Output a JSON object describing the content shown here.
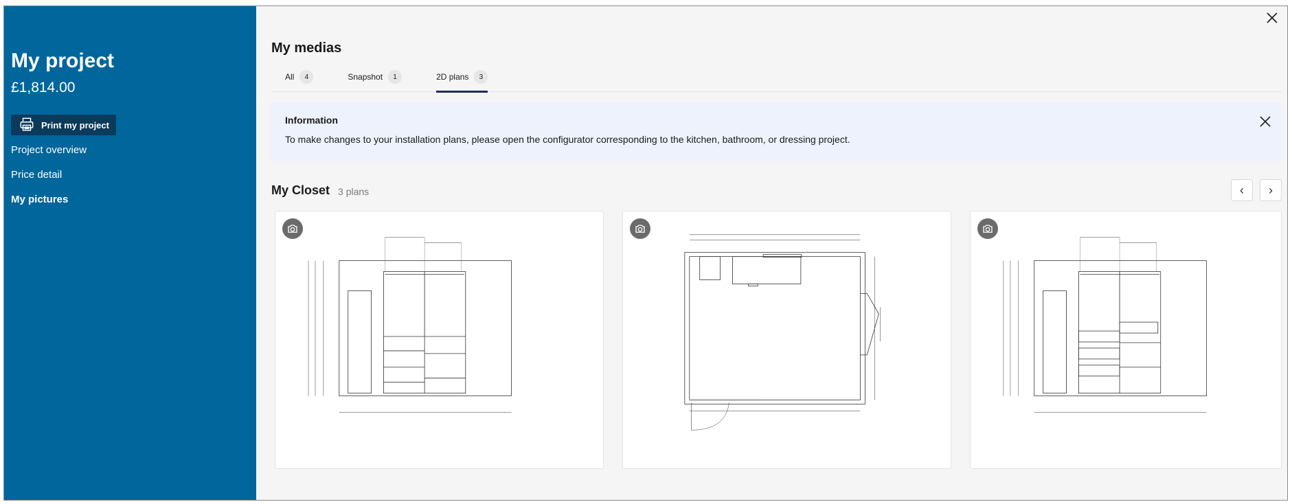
{
  "sidebar": {
    "title": "My project",
    "price": "£1,814.00",
    "print_label": "Print my project",
    "items": [
      {
        "label": "Project overview"
      },
      {
        "label": "Price detail"
      },
      {
        "label": "My pictures"
      }
    ]
  },
  "main": {
    "title": "My medias",
    "tabs": [
      {
        "label": "All",
        "count": "4"
      },
      {
        "label": "Snapshot",
        "count": "1"
      },
      {
        "label": "2D plans",
        "count": "3"
      }
    ],
    "active_tab": "2D plans",
    "info": {
      "title": "Information",
      "text": "To make changes to your installation plans, please open the configurator corresponding to the kitchen, bathroom, or dressing project."
    },
    "section": {
      "title": "My Closet",
      "subtitle": "3 plans",
      "prev": "‹",
      "next": "›"
    }
  },
  "colors": {
    "sidebar_bg": "#00669b",
    "print_btn_bg": "#0b3a5a",
    "tab_underline": "#1f2b5c",
    "info_bg": "#edf2fd"
  },
  "icons": [
    "close-icon",
    "printer-icon",
    "camera-icon",
    "chevron-left-icon",
    "chevron-right-icon"
  ]
}
